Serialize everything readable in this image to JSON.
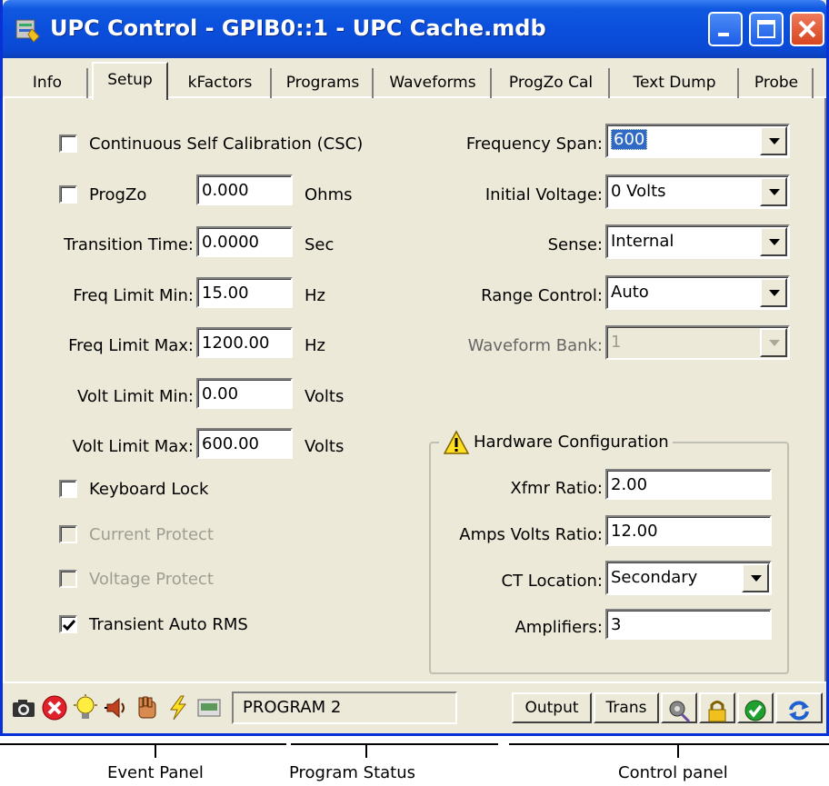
{
  "window": {
    "title": "UPC Control - GPIB0::1 - UPC Cache.mdb",
    "controls": [
      "minimize-icon",
      "maximize-icon",
      "close-icon"
    ]
  },
  "tabs": [
    {
      "label": "Info",
      "active": false
    },
    {
      "label": "Setup",
      "active": true
    },
    {
      "label": "kFactors",
      "active": false
    },
    {
      "label": "Programs",
      "active": false
    },
    {
      "label": "Waveforms",
      "active": false
    },
    {
      "label": "ProgZo Cal",
      "active": false
    },
    {
      "label": "Text Dump",
      "active": false
    },
    {
      "label": "Probe",
      "active": false
    }
  ],
  "setup": {
    "csc": {
      "label": "Continuous Self Calibration (CSC)",
      "checked": false
    },
    "progzo": {
      "label": "ProgZo",
      "checked": false,
      "value": "0.000",
      "unit": "Ohms"
    },
    "transition_time": {
      "label": "Transition Time:",
      "value": "0.0000",
      "unit": "Sec"
    },
    "freq_min": {
      "label": "Freq Limit Min:",
      "value": "15.00",
      "unit": "Hz"
    },
    "freq_max": {
      "label": "Freq Limit Max:",
      "value": "1200.00",
      "unit": "Hz"
    },
    "volt_min": {
      "label": "Volt Limit Min:",
      "value": "0.00",
      "unit": "Volts"
    },
    "volt_max": {
      "label": "Volt Limit Max:",
      "value": "600.00",
      "unit": "Volts"
    },
    "keyboard_lock": {
      "label": "Keyboard Lock",
      "checked": false
    },
    "current_protect": {
      "label": "Current Protect",
      "checked": false,
      "disabled": true
    },
    "voltage_protect": {
      "label": "Voltage Protect",
      "checked": false,
      "disabled": true
    },
    "transient_auto_rms": {
      "label": "Transient Auto RMS",
      "checked": true
    },
    "frequency_span": {
      "label": "Frequency Span:",
      "value": "600"
    },
    "initial_voltage": {
      "label": "Initial Voltage:",
      "value": "0 Volts"
    },
    "sense": {
      "label": "Sense:",
      "value": "Internal"
    },
    "range_control": {
      "label": "Range Control:",
      "value": "Auto"
    },
    "waveform_bank": {
      "label": "Waveform Bank:",
      "value": "1",
      "disabled": true
    },
    "hardware": {
      "title": "Hardware Configuration",
      "icon": "warning-icon",
      "xfmr_ratio": {
        "label": "Xfmr Ratio:",
        "value": "2.00"
      },
      "amps_volts_ratio": {
        "label": "Amps Volts Ratio:",
        "value": "12.00"
      },
      "ct_location": {
        "label": "CT Location:",
        "value": "Secondary"
      },
      "amplifiers": {
        "label": "Amplifiers:",
        "value": "3"
      }
    }
  },
  "statusbar": {
    "event_icons": [
      "camera-icon",
      "error-icon",
      "lightbulb-icon",
      "speaker-icon",
      "hand-icon",
      "lightning-icon",
      "display-icon"
    ],
    "program_status": "PROGRAM 2",
    "output_label": "Output",
    "trans_label": "Trans",
    "control_icons": [
      "probe-icon",
      "lock-icon",
      "ok-icon",
      "refresh-icon"
    ]
  },
  "callouts": {
    "event_panel": "Event Panel",
    "program_status": "Program  Status",
    "control_panel": "Control panel"
  },
  "colors": {
    "titlebar": "#0a4fdc",
    "face": "#ece9d8",
    "selection": "#316ac5",
    "close": "#d8461f"
  }
}
